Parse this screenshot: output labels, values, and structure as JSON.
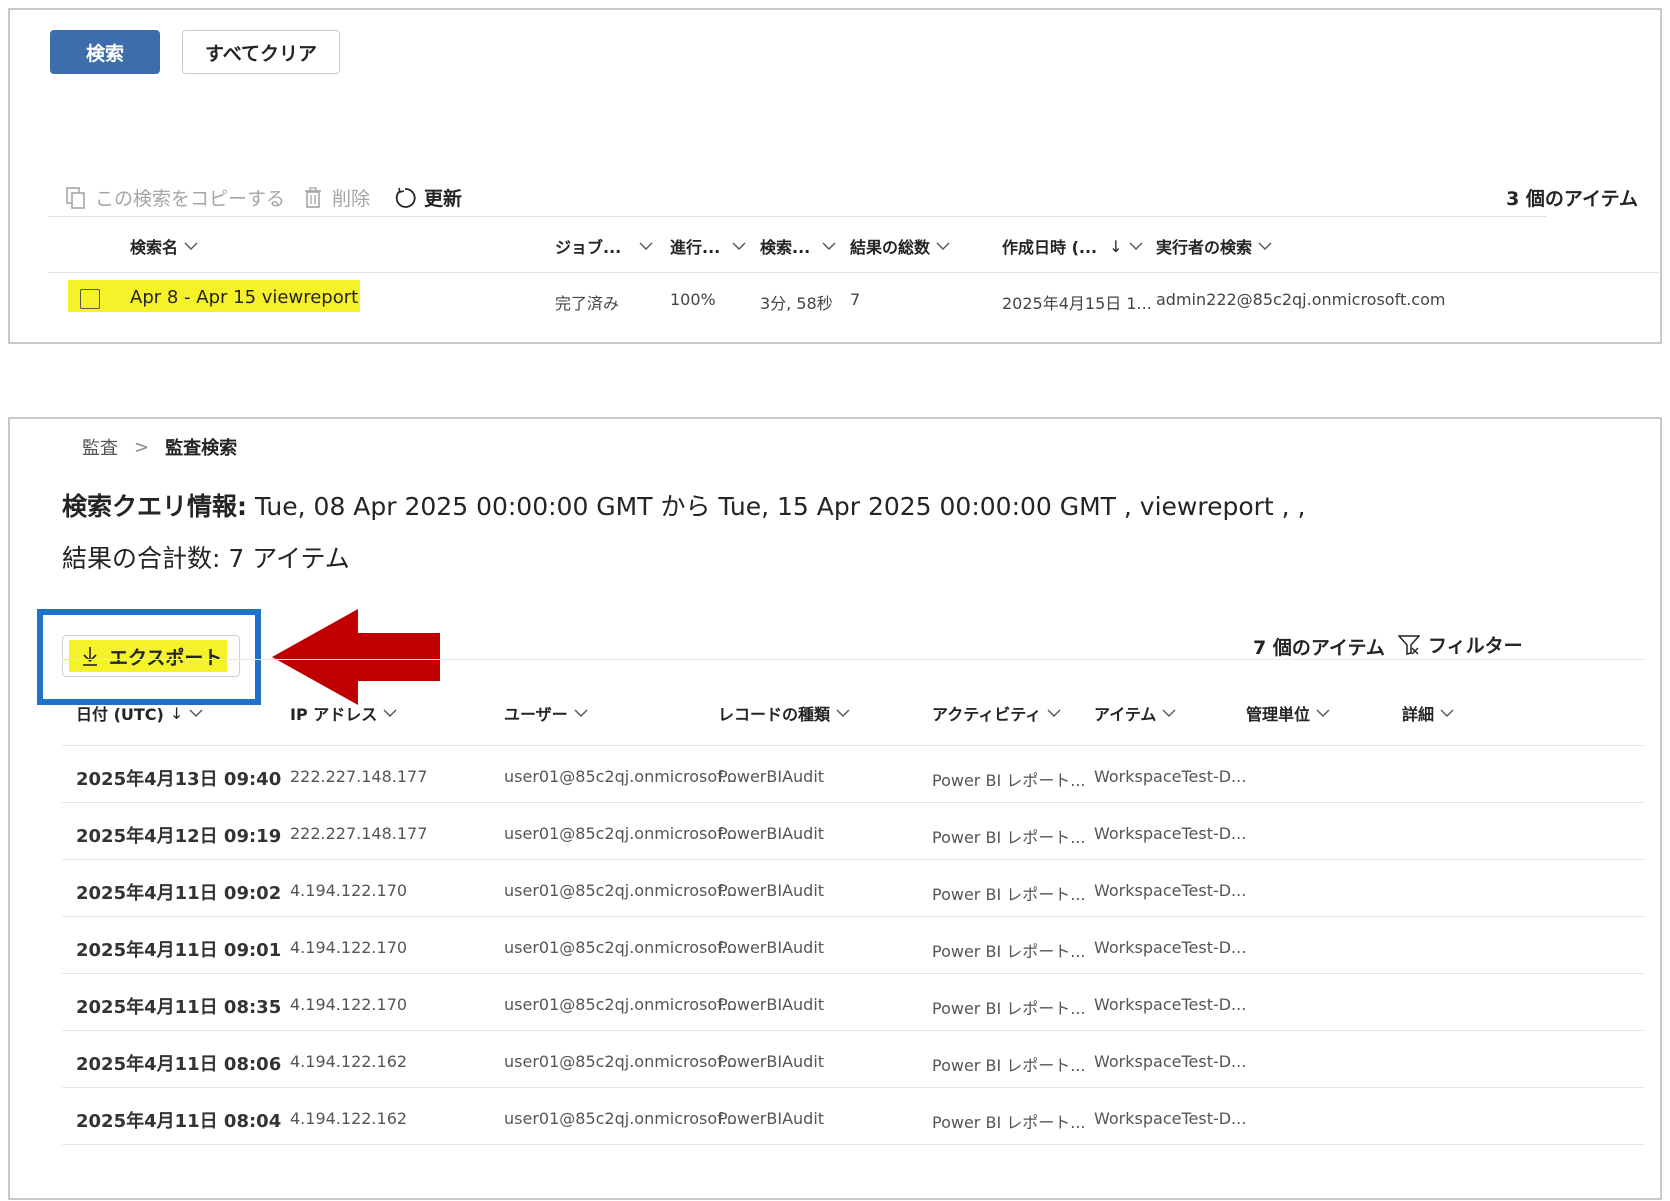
{
  "top": {
    "search_button": "検索",
    "clear_all_button": "すべてクリア",
    "commands": {
      "copy": "この検索をコピーする",
      "delete": "削除",
      "refresh": "更新"
    },
    "item_count": "3 個のアイテム",
    "columns": [
      "検索名",
      "ジョブ...",
      "進行...",
      "検索...",
      "結果の総数",
      "作成日時 (...",
      "実行者の検索"
    ],
    "row": {
      "name": "Apr 8 - Apr 15 viewreport",
      "job": "完了済み",
      "progress": "100%",
      "duration": "3分, 58秒",
      "total": "7",
      "created": "2025年4月15日 1...",
      "runner": "admin222@85c2qj.onmicrosoft.com"
    }
  },
  "bottom": {
    "breadcrumb": [
      "監査",
      "監査検索"
    ],
    "query_label": "検索クエリ情報:",
    "query_text": " Tue, 08 Apr 2025 00:00:00 GMT から Tue, 15 Apr 2025 00:00:00 GMT , viewreport , ,",
    "total_label": "結果の合計数: 7 アイテム",
    "export_button": "エクスポート",
    "item_count": "7 個のアイテム",
    "filter_button": "フィルター",
    "columns": [
      "日付 (UTC)",
      "IP アドレス",
      "ユーザー",
      "レコードの種類",
      "アクティビティ",
      "アイテム",
      "管理単位",
      "詳細"
    ],
    "rows": [
      {
        "date": "2025年4月13日 09:40",
        "ip": "222.227.148.177",
        "user": "user01@85c2qj.onmicrosof...",
        "record": "PowerBIAudit",
        "activity": "Power BI レポート...",
        "item": "WorkspaceTest-D..."
      },
      {
        "date": "2025年4月12日 09:19",
        "ip": "222.227.148.177",
        "user": "user01@85c2qj.onmicrosof...",
        "record": "PowerBIAudit",
        "activity": "Power BI レポート...",
        "item": "WorkspaceTest-D..."
      },
      {
        "date": "2025年4月11日 09:02",
        "ip": "4.194.122.170",
        "user": "user01@85c2qj.onmicrosof...",
        "record": "PowerBIAudit",
        "activity": "Power BI レポート...",
        "item": "WorkspaceTest-D..."
      },
      {
        "date": "2025年4月11日 09:01",
        "ip": "4.194.122.170",
        "user": "user01@85c2qj.onmicrosof...",
        "record": "PowerBIAudit",
        "activity": "Power BI レポート...",
        "item": "WorkspaceTest-D..."
      },
      {
        "date": "2025年4月11日 08:35",
        "ip": "4.194.122.170",
        "user": "user01@85c2qj.onmicrosof...",
        "record": "PowerBIAudit",
        "activity": "Power BI レポート...",
        "item": "WorkspaceTest-D..."
      },
      {
        "date": "2025年4月11日 08:06",
        "ip": "4.194.122.162",
        "user": "user01@85c2qj.onmicrosof...",
        "record": "PowerBIAudit",
        "activity": "Power BI レポート...",
        "item": "WorkspaceTest-D..."
      },
      {
        "date": "2025年4月11日 08:04",
        "ip": "4.194.122.162",
        "user": "user01@85c2qj.onmicrosof...",
        "record": "PowerBIAudit",
        "activity": "Power BI レポート...",
        "item": "WorkspaceTest-D..."
      }
    ]
  },
  "colors": {
    "primary": "#3e6dad",
    "highlight": "#f6f22a",
    "callout_box": "#1e73c8",
    "arrow": "#c00000"
  }
}
